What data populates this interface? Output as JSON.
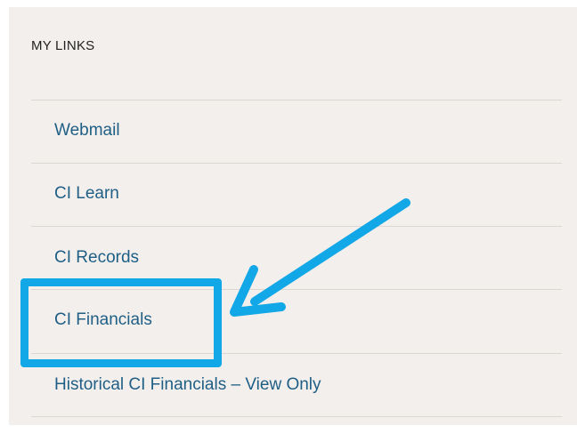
{
  "sidebar": {
    "heading": "MY LINKS",
    "links": [
      {
        "label": "Webmail"
      },
      {
        "label": "CI Learn"
      },
      {
        "label": "CI Records"
      },
      {
        "label": "CI Financials"
      },
      {
        "label": "Historical CI Financials – View Only"
      }
    ]
  },
  "annotation": {
    "highlight_color": "#12a7e6",
    "arrow_color": "#12a7e6",
    "highlighted_link": "CI Financials"
  },
  "colors": {
    "panel_background": "#f3efec",
    "link_color": "#1f5f86",
    "heading_color": "#222222"
  }
}
